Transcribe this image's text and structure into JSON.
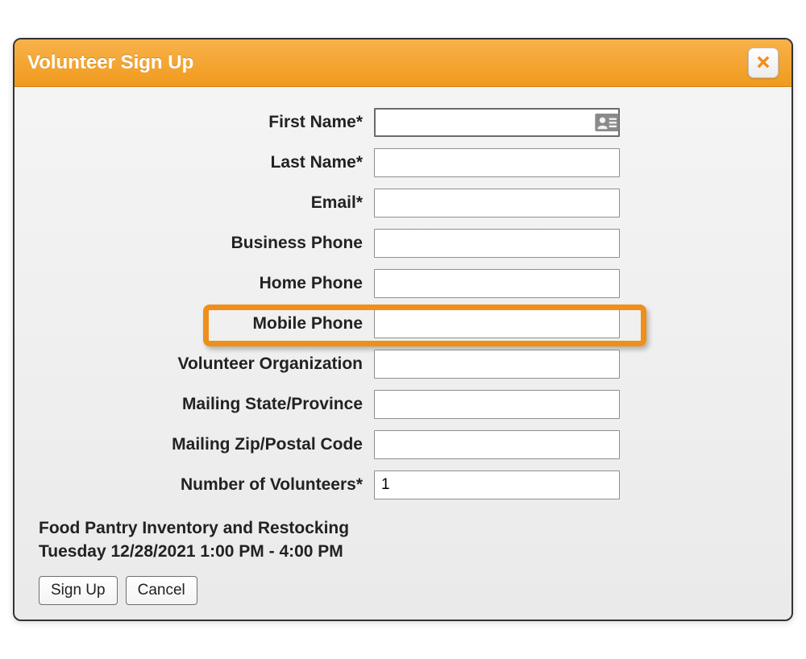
{
  "dialog": {
    "title": "Volunteer Sign Up"
  },
  "form": {
    "first_name": {
      "label": "First Name*",
      "value": ""
    },
    "last_name": {
      "label": "Last Name*",
      "value": ""
    },
    "email": {
      "label": "Email*",
      "value": ""
    },
    "business_phone": {
      "label": "Business Phone",
      "value": ""
    },
    "home_phone": {
      "label": "Home Phone",
      "value": ""
    },
    "mobile_phone": {
      "label": "Mobile Phone",
      "value": ""
    },
    "volunteer_org": {
      "label": "Volunteer Organization",
      "value": ""
    },
    "mailing_state": {
      "label": "Mailing State/Province",
      "value": ""
    },
    "mailing_zip": {
      "label": "Mailing Zip/Postal Code",
      "value": ""
    },
    "num_volunteers": {
      "label": "Number of Volunteers*",
      "value": "1"
    }
  },
  "event": {
    "name": "Food Pantry Inventory and Restocking",
    "datetime": "Tuesday 12/28/2021 1:00 PM - 4:00 PM"
  },
  "buttons": {
    "signup": "Sign Up",
    "cancel": "Cancel"
  }
}
